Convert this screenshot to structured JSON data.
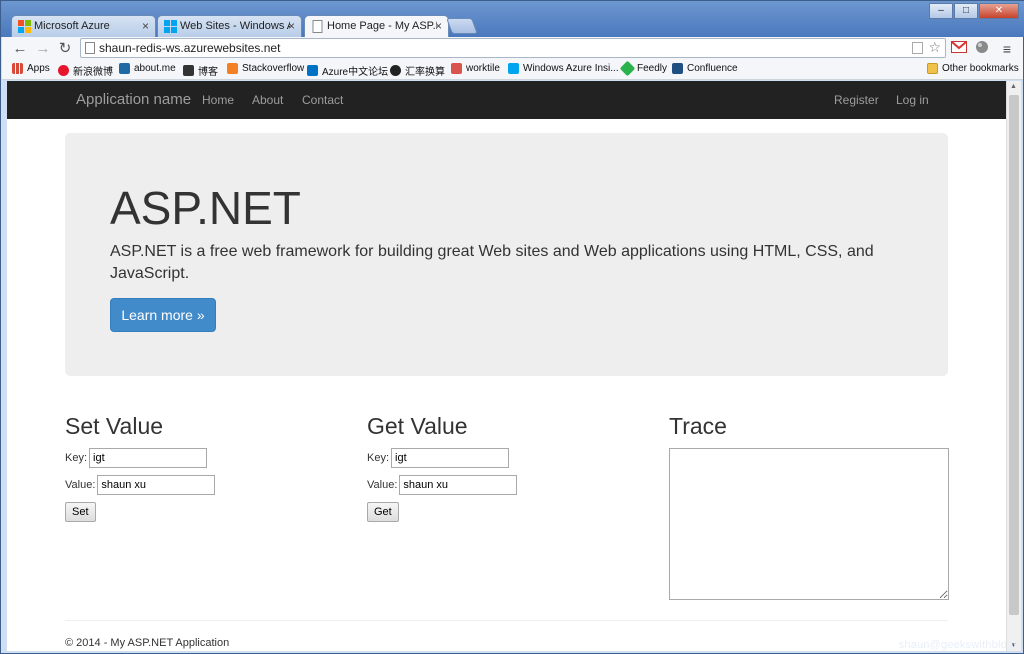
{
  "browser": {
    "tabs": [
      {
        "label": "Microsoft Azure",
        "active": false
      },
      {
        "label": "Web Sites - Windows Azu",
        "active": false
      },
      {
        "label": "Home Page - My ASP.NET",
        "active": true
      }
    ],
    "window_controls": {
      "minimize": "–",
      "maximize": "□",
      "close": "✕"
    },
    "address": "shaun-redis-ws.azurewebsites.net",
    "nav_icons": {
      "back": "←",
      "forward": "→",
      "reload": "↻"
    },
    "bookmarks": [
      {
        "label": "Apps",
        "color": "#d84a38"
      },
      {
        "label": "新浪微博",
        "color": "#e6162d"
      },
      {
        "label": "about.me",
        "color": "#1f6aa5"
      },
      {
        "label": "博客",
        "color": "#333333"
      },
      {
        "label": "Stackoverflow",
        "color": "#f48024"
      },
      {
        "label": "Azure中文论坛",
        "color": "#0072c6"
      },
      {
        "label": "汇率换算",
        "color": "#222222"
      },
      {
        "label": "worktile",
        "color": "#d9534f"
      },
      {
        "label": "Windows Azure Insi...",
        "color": "#00a4ef"
      },
      {
        "label": "Feedly",
        "color": "#2bb24c"
      },
      {
        "label": "Confluence",
        "color": "#205081"
      }
    ],
    "other_bookmarks": "Other bookmarks"
  },
  "navbar": {
    "brand": "Application name",
    "links": [
      "Home",
      "About",
      "Contact"
    ],
    "right_links": [
      "Register",
      "Log in"
    ]
  },
  "jumbotron": {
    "title": "ASP.NET",
    "lead": "ASP.NET is a free web framework for building great Web sites and Web applications using HTML, CSS, and JavaScript.",
    "button": "Learn more »"
  },
  "set_value": {
    "heading": "Set Value",
    "key_label": "Key:",
    "key_value": "igt",
    "value_label": "Value:",
    "value_value": "shaun xu",
    "button": "Set"
  },
  "get_value": {
    "heading": "Get Value",
    "key_label": "Key:",
    "key_value": "igt",
    "value_label": "Value:",
    "value_value": "shaun xu",
    "button": "Get"
  },
  "trace": {
    "heading": "Trace",
    "content": ""
  },
  "footer": "© 2014 - My ASP.NET Application",
  "watermark": "shaun@geekswithblogs",
  "colors": {
    "navbar_bg": "#222222",
    "jumbotron_bg": "#eeeeee",
    "primary": "#428bca"
  }
}
